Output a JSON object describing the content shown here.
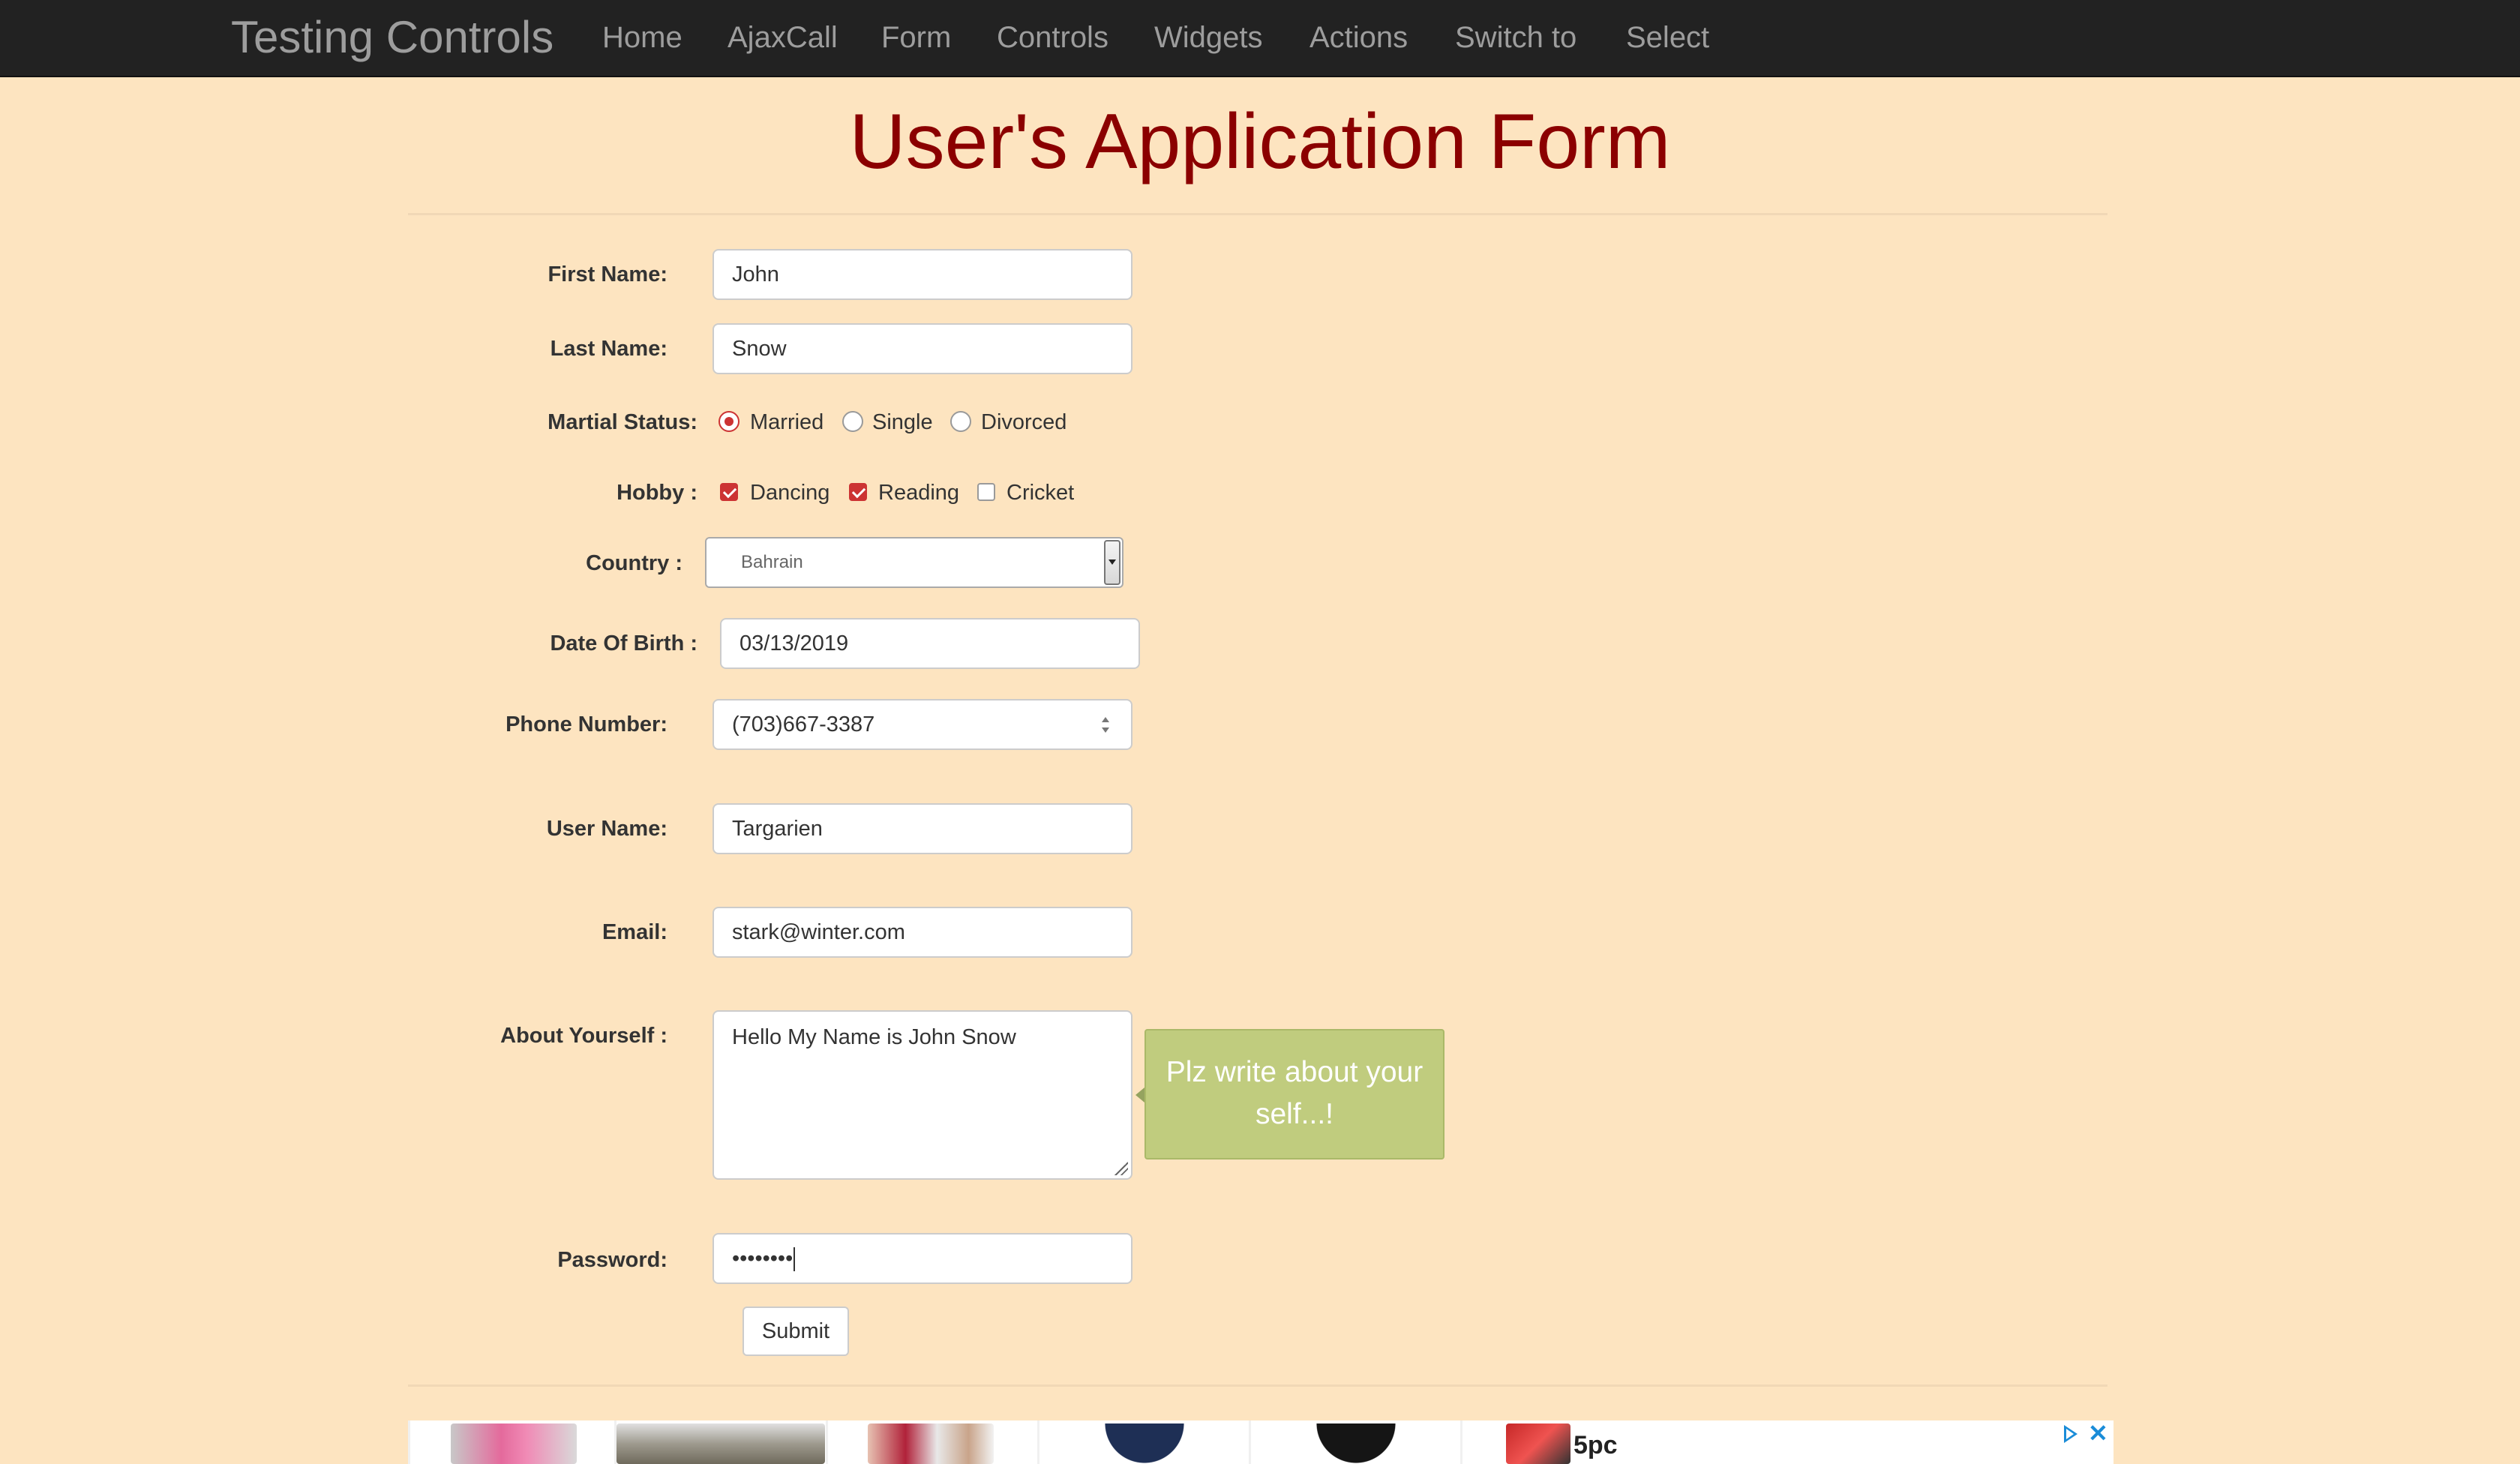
{
  "navbar": {
    "brand": "Testing Controls",
    "items": [
      "Home",
      "AjaxCall",
      "Form",
      "Controls",
      "Widgets",
      "Actions",
      "Switch to",
      "Select"
    ]
  },
  "page": {
    "title": "User's Application Form"
  },
  "form": {
    "first_name": {
      "label": "First Name:",
      "value": "John"
    },
    "last_name": {
      "label": "Last Name:",
      "value": "Snow"
    },
    "marital_status": {
      "label": "Martial Status:",
      "options": [
        "Married",
        "Single",
        "Divorced"
      ],
      "selected": "Married"
    },
    "hobby": {
      "label": "Hobby :",
      "options": [
        {
          "label": "Dancing",
          "checked": true
        },
        {
          "label": "Reading",
          "checked": true
        },
        {
          "label": "Cricket",
          "checked": false
        }
      ]
    },
    "country": {
      "label": "Country :",
      "value": "Bahrain"
    },
    "dob": {
      "label": "Date Of Birth :",
      "value": "03/13/2019"
    },
    "phone": {
      "label": "Phone Number:",
      "value": "(703)667-3387"
    },
    "username": {
      "label": "User Name:",
      "value": "Targarien"
    },
    "email": {
      "label": "Email:",
      "value": "stark@winter.com"
    },
    "about": {
      "label": "About Yourself :",
      "value": "Hello My Name is John Snow",
      "tooltip": "Plz write about your self...!"
    },
    "password": {
      "label": "Password:",
      "masked_value": "••••••••"
    },
    "submit_label": "Submit"
  },
  "ad": {
    "badge": "5pc",
    "close_symbol": "✕"
  },
  "colors": {
    "background": "#fde4c0",
    "navbar": "#222222",
    "title": "#8b0000",
    "accent": "#cc3333",
    "tooltip": "#c0cc7e"
  }
}
